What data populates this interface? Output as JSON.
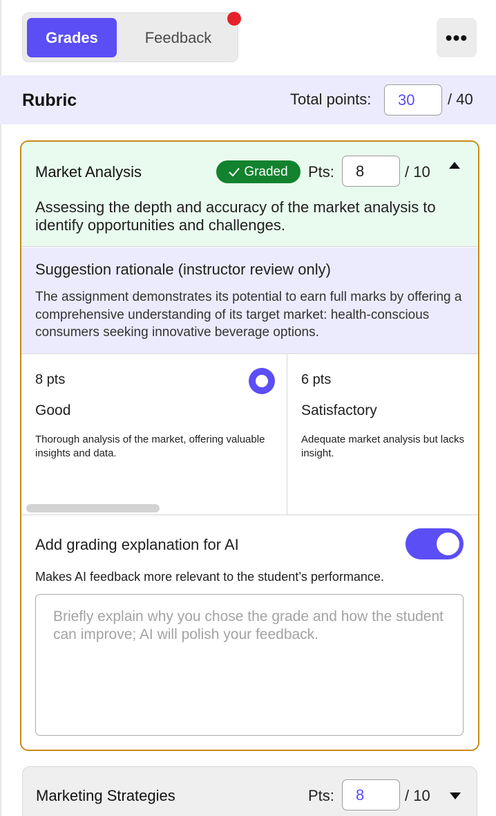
{
  "tabs": [
    {
      "label": "Grades",
      "active": true
    },
    {
      "label": "Feedback",
      "active": false
    }
  ],
  "more_icon": "more-horizontal-icon",
  "more_label": "•••",
  "colors": {
    "accent": "#5b4ef5",
    "graded": "#12822e",
    "active_border": "#c98a16",
    "notification": "#e5222a"
  },
  "rubric": {
    "title": "Rubric",
    "total_label": "Total points:",
    "total_value": "30",
    "total_max": "/ 40"
  },
  "criteria": [
    {
      "title": "Market Analysis",
      "badge": "Graded",
      "badge_icon": "check-icon",
      "pts_label": "Pts:",
      "pts_value": "8",
      "pts_max": "/ 10",
      "description": "Assessing the depth and accuracy of the market analysis to identify opportunities and challenges.",
      "rationale_title": "Suggestion rationale (instructor review only)",
      "rationale_text": "The assignment demonstrates its potential to earn full marks by offering a comprehensive understanding of its target market: health-conscious consumers seeking innovative beverage options.",
      "levels": [
        {
          "pts": "8 pts",
          "name": "Good",
          "description": "Thorough analysis of the market, offering valuable insights and data.",
          "selected": true
        },
        {
          "pts": "6 pts",
          "name": "Satisfactory",
          "description_line1": "Adequate market analysis but lacks",
          "description_line2": "insight.",
          "selected": false
        }
      ],
      "explanation": {
        "title": "Add grading explanation for AI",
        "toggle_on": true,
        "subtitle": "Makes AI feedback more relevant to the student’s performance.",
        "placeholder": "Briefly explain why you chose the grade and how the student can improve; AI will polish your feedback."
      }
    },
    {
      "title": "Marketing Strategies",
      "pts_label": "Pts:",
      "pts_value": "8",
      "pts_max": "/ 10"
    }
  ]
}
